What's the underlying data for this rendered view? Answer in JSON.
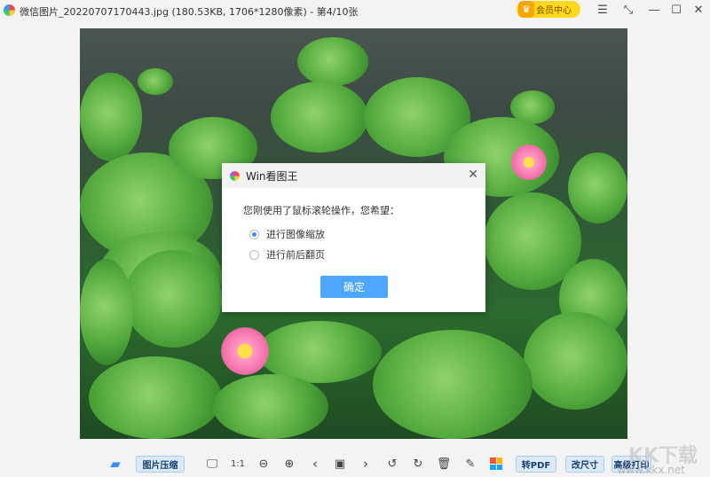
{
  "titlebar": {
    "title": "微信图片_20220707170443.jpg (180.53KB, 1706*1280像素) - 第4/10张",
    "vip_label": "会员中心",
    "menu": "☰",
    "fullscreen": "⤡",
    "minimize": "—",
    "maximize": "☐",
    "close": "✕"
  },
  "dialog": {
    "title": "Win看图王",
    "close": "✕",
    "message": "您刚使用了鼠标滚轮操作，您希望：",
    "options": [
      {
        "label": "进行图像缩放",
        "selected": true
      },
      {
        "label": "进行前后翻页",
        "selected": false
      }
    ],
    "confirm": "确定"
  },
  "toolbar": {
    "compress": "图片压缩",
    "actual_size": "1:1",
    "to_pdf": "转PDF",
    "resize": "改尺寸",
    "print": "高级打印"
  },
  "watermark": {
    "logo": "KK下载",
    "url": "www.kkx.net"
  }
}
